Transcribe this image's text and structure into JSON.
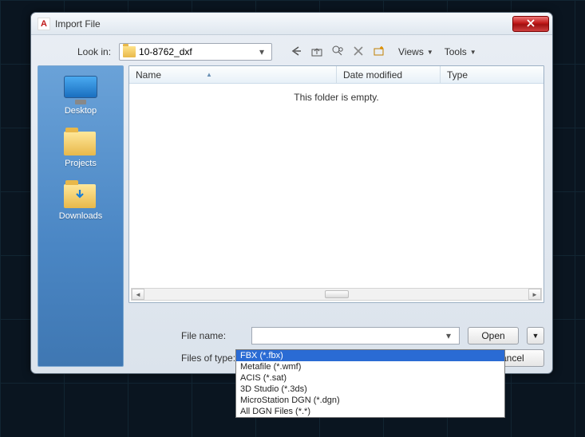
{
  "window": {
    "title": "Import File",
    "app_glyph": "A"
  },
  "toolbar": {
    "look_in_label": "Look in:",
    "look_in_value": "10-8762_dxf",
    "views_label": "Views",
    "tools_label": "Tools"
  },
  "sidebar": {
    "items": [
      {
        "label": "Desktop"
      },
      {
        "label": "Projects"
      },
      {
        "label": "Downloads"
      }
    ]
  },
  "columns": {
    "name": "Name",
    "date": "Date modified",
    "type": "Type"
  },
  "list": {
    "empty_message": "This folder is empty."
  },
  "bottom": {
    "file_name_label": "File name:",
    "file_name_value": "",
    "files_of_type_label": "Files of type:",
    "files_of_type_value": "FBX (*.fbx)",
    "open_label": "Open",
    "cancel_label": "Cancel"
  },
  "filetype_options": [
    "FBX (*.fbx)",
    "Metafile (*.wmf)",
    "ACIS (*.sat)",
    "3D Studio (*.3ds)",
    "MicroStation DGN (*.dgn)",
    "All DGN Files (*.*)"
  ]
}
